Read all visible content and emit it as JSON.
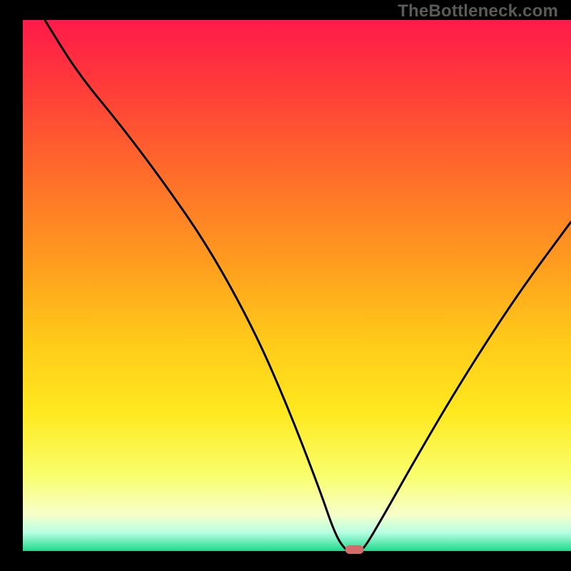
{
  "watermark": "TheBottleneck.com",
  "colors": {
    "black": "#000000",
    "marker": "#d46a6a",
    "curve": "#000000",
    "gradient_stops": [
      {
        "offset": 0.0,
        "color": "#ff1a4a"
      },
      {
        "offset": 0.12,
        "color": "#ff3a3a"
      },
      {
        "offset": 0.28,
        "color": "#ff6a2b"
      },
      {
        "offset": 0.45,
        "color": "#ff9a1f"
      },
      {
        "offset": 0.6,
        "color": "#ffc919"
      },
      {
        "offset": 0.74,
        "color": "#ffe91f"
      },
      {
        "offset": 0.86,
        "color": "#f9ff6e"
      },
      {
        "offset": 0.93,
        "color": "#f8ffc8"
      },
      {
        "offset": 0.965,
        "color": "#b8ffe2"
      },
      {
        "offset": 1.0,
        "color": "#1fd98f"
      }
    ]
  },
  "chart_data": {
    "type": "line",
    "title": "",
    "xlabel": "",
    "ylabel": "",
    "xlim": [
      0,
      100
    ],
    "ylim": [
      0,
      100
    ],
    "grid": false,
    "legend": false,
    "series": [
      {
        "name": "bottleneck-curve",
        "x": [
          4,
          10,
          18,
          26,
          34,
          42,
          48,
          54,
          57,
          59,
          60,
          61,
          62,
          66,
          72,
          80,
          90,
          100
        ],
        "y": [
          100,
          90,
          80,
          69,
          57,
          42,
          28,
          12,
          3,
          0,
          0,
          0,
          0,
          7,
          18,
          32,
          48,
          62
        ]
      }
    ],
    "marker": {
      "x": 60.5,
      "y": 0,
      "label": "optimal-point"
    }
  }
}
